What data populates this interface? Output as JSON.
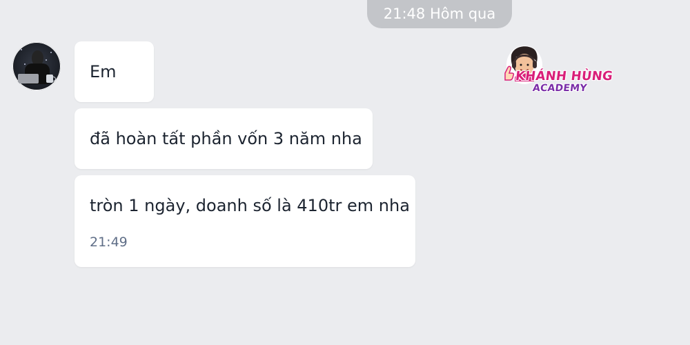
{
  "chat": {
    "date_separator": "21:48 Hôm qua",
    "messages": [
      {
        "text": "Em"
      },
      {
        "text": "đã hoàn tất phần vốn 3 năm nha"
      },
      {
        "text": "tròn 1 ngày, doanh số là 410tr em nha",
        "time": "21:49"
      }
    ]
  },
  "logo": {
    "line_1": "KHÁNH HÙNG",
    "line_2": "ACADEMY",
    "colors": {
      "primary": "#d91f79",
      "secondary": "#7b2ea8"
    }
  },
  "icons": {
    "avatar": "contact-avatar",
    "logo_mascot": "logo-mascot-icon"
  },
  "theme": {
    "background": "#ebecef",
    "bubble": "#ffffff",
    "time_pill": "#c3c5c9",
    "text": "#1c2430",
    "timestamp": "#5f6e87"
  }
}
